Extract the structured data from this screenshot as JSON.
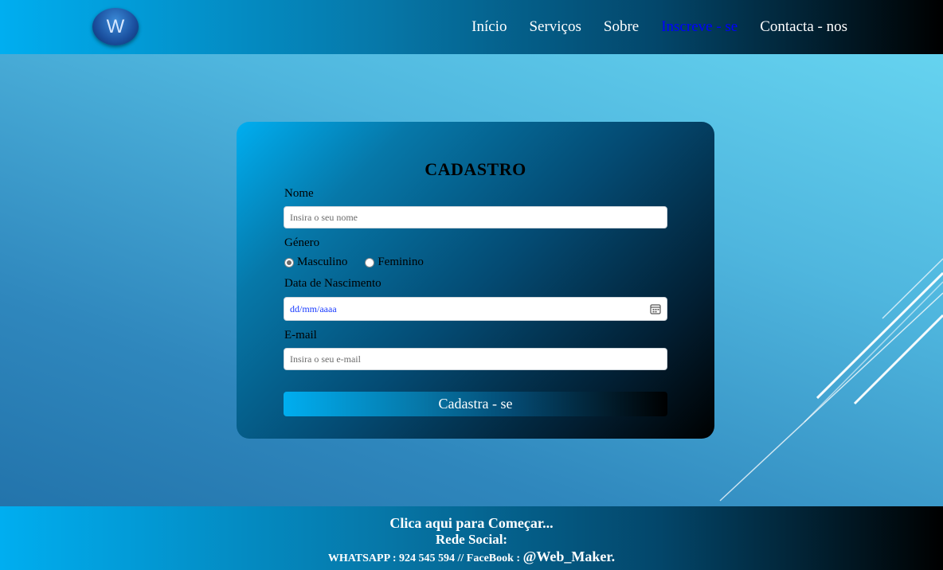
{
  "header": {
    "logo_letter": "W",
    "nav": [
      {
        "label": "Início",
        "active": false
      },
      {
        "label": "Serviços",
        "active": false
      },
      {
        "label": "Sobre",
        "active": false
      },
      {
        "label": "Inscreve - se",
        "active": true
      },
      {
        "label": "Contacta - nos",
        "active": false
      }
    ]
  },
  "form": {
    "title": "CADASTRO",
    "name_label": "Nome",
    "name_placeholder": "Insira o seu nome",
    "gender_label": "Género",
    "gender_options": [
      {
        "label": "Masculino",
        "checked": true
      },
      {
        "label": "Feminino",
        "checked": false
      }
    ],
    "birthdate_label": "Data de Nascimento",
    "birthdate_placeholder": "dd/mm/aaaa",
    "email_label": "E-mail",
    "email_placeholder": "Insira o seu e-mail",
    "submit_label": "Cadastra - se"
  },
  "footer": {
    "cta": "Clica aqui para Começar...",
    "social_title": "Rede Social:",
    "contacts_prefix": "WHATSAPP : 924 545 594 // FaceBook : ",
    "handle": "@Web_Maker."
  },
  "colors": {
    "active_nav": "#0000ff",
    "accent_start": "#00aef0",
    "accent_end": "#000000",
    "background": "#4fb6de"
  }
}
